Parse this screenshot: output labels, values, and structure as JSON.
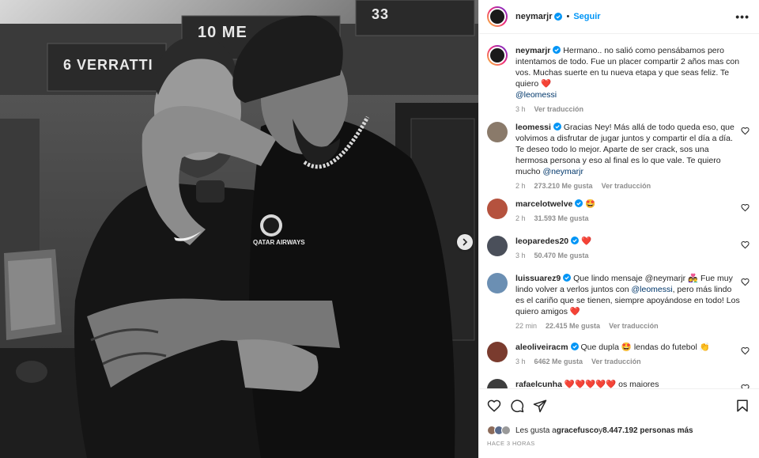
{
  "photo": {
    "locker_top": "10 ME",
    "locker_top_right": "33",
    "locker_name": "6 VERRATTI",
    "next_icon": "chevron-right-icon",
    "shirt_brand": "QATAR AIRWAYS",
    "shirt_crest": "PARIS"
  },
  "header": {
    "username": "neymarjr",
    "separator": "•",
    "follow_label": "Seguir",
    "more_label": "•••"
  },
  "comments": [
    {
      "username": "neymarjr",
      "pre": " Hermano.. no salió como pensábamos pero intentamos de todo. Fue un placer compartir 2 años mas con vos. Muchas suerte en tu nueva etapa y que seas feliz. Te quiero ",
      "emoji": "❤️",
      "mention": "@leomessi",
      "post": "",
      "time": "3 h",
      "likes": "",
      "reply": "",
      "translate": "Ver traducción",
      "avatar_color": "#1a1a1a",
      "verified": true
    },
    {
      "username": "leomessi",
      "pre": " Gracias Ney! Más allá de todo queda eso, que volvimos a disfrutar de jugar juntos y compartir el día a día. Te deseo todo lo mejor. Aparte de ser crack, sos una hermosa persona y eso al final es lo que vale. Te quiero mucho ",
      "emoji": "",
      "mention": "@neymarjr",
      "post": "",
      "time": "2 h",
      "likes": "273.210 Me gusta",
      "reply": "",
      "translate": "Ver traducción",
      "avatar_color": "#8a7a6a",
      "verified": true
    },
    {
      "username": "marcelotwelve",
      "pre": " ",
      "emoji": "🤩",
      "mention": "",
      "post": "",
      "time": "2 h",
      "likes": "31.593 Me gusta",
      "reply": "",
      "translate": "",
      "avatar_color": "#b5523e",
      "verified": true
    },
    {
      "username": "leoparedes20",
      "pre": " ",
      "emoji": "❤️",
      "mention": "",
      "post": "",
      "time": "3 h",
      "likes": "50.470 Me gusta",
      "reply": "",
      "translate": "",
      "avatar_color": "#4a4f5a",
      "verified": true
    },
    {
      "username": "luissuarez9",
      "pre": " Que lindo mensaje @neymarjr 👩‍❤️‍👨 Fue muy lindo volver a verlos juntos con ",
      "emoji": "",
      "mention": "@leomessi",
      "post": ", pero más lindo es el cariño que se tienen, siempre apoyándose en todo! Los quiero amigos ❤️",
      "time": "22 min",
      "likes": "22.415 Me gusta",
      "reply": "",
      "translate": "Ver traducción",
      "avatar_color": "#6b8fb3",
      "verified": true
    },
    {
      "username": "aleoliveiracm",
      "pre": " Que dupla 🤩 lendas do futebol 👏",
      "emoji": "",
      "mention": "",
      "post": "",
      "time": "3 h",
      "likes": "6462 Me gusta",
      "reply": "",
      "translate": "Ver traducción",
      "avatar_color": "#7a3b2e",
      "verified": true
    },
    {
      "username": "rafaelcunha",
      "pre": " ❤️❤️❤️❤️❤️ os maiores",
      "emoji": "",
      "mention": "",
      "post": "",
      "time": "",
      "likes": "",
      "reply": "",
      "translate": "",
      "avatar_color": "#3d3d3d",
      "verified": false
    }
  ],
  "actions": {
    "like_icon": "heart-icon",
    "comment_icon": "comment-icon",
    "share_icon": "send-icon",
    "save_icon": "bookmark-icon",
    "likes_prefix": "Les gusta a ",
    "likes_user": "gracefusco",
    "likes_mid": " y ",
    "likes_count": "8.447.192 personas más",
    "timestamp": "HACE 3 HORAS"
  },
  "colors": {
    "accent": "#0095f6",
    "mention": "#00376b",
    "heart": "#ed4956",
    "muted": "#8e8e8e"
  }
}
